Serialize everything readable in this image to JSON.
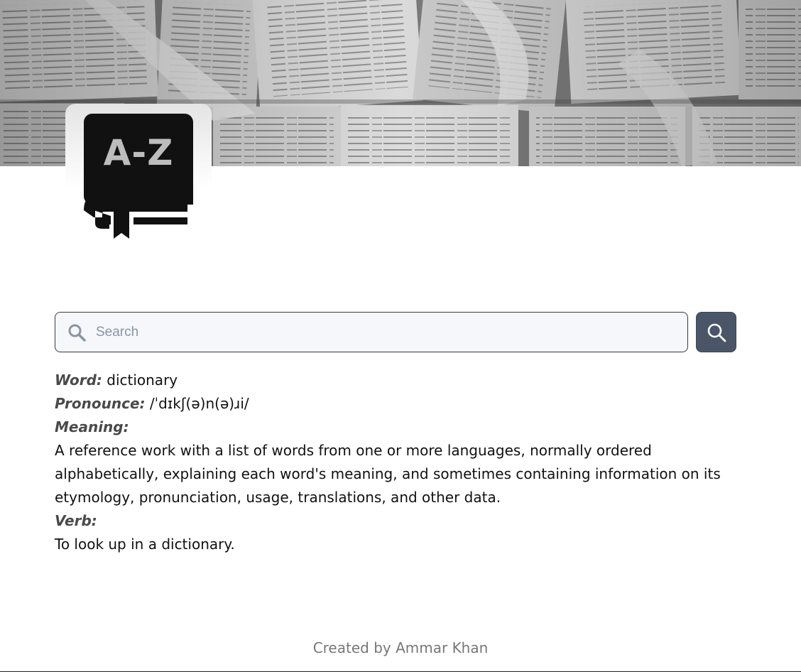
{
  "app": {
    "logo_text": "A-Z"
  },
  "icons": {
    "search_field_icon": "search-icon",
    "search_button_icon": "search-icon",
    "logo_icon": "dictionary-book-icon"
  },
  "colors": {
    "button_bg": "#4a5568",
    "label_color": "#4a4a4a",
    "footer_color": "#777777"
  },
  "search": {
    "placeholder": "Search",
    "value": ""
  },
  "result": {
    "word_label": "Word:",
    "word": "dictionary",
    "pronounce_label": "Pronounce:",
    "pronounce": "/ˈdɪkʃ(ə)n(ə)ɹi/",
    "meaning_label": "Meaning:",
    "meaning": "A reference work with a list of words from one or more languages, normally ordered alphabetically, explaining each word's meaning, and sometimes containing information on its etymology, pronunciation, usage, translations, and other data.",
    "verb_label": "Verb:",
    "verb": "To look up in a dictionary."
  },
  "footer": {
    "credit": "Created by Ammar Khan"
  }
}
